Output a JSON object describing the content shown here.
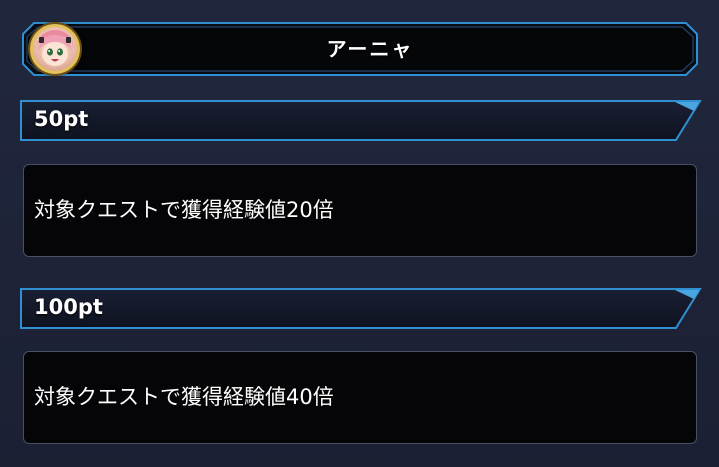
{
  "character": {
    "name": "アーニャ",
    "avatar_icon": "character-portrait-icon"
  },
  "rewards": [
    {
      "points_label": "50pt",
      "description": "対象クエストで獲得経験値20倍"
    },
    {
      "points_label": "100pt",
      "description": "対象クエストで獲得経験値40倍"
    }
  ],
  "colors": {
    "background": "#1d2236",
    "frame_blue": "#2f8fd0",
    "bar_fill": "#14182a",
    "reward_box_fill": "#050507",
    "reward_box_border": "#4a5066",
    "avatar_ring": "#e2c05a"
  }
}
